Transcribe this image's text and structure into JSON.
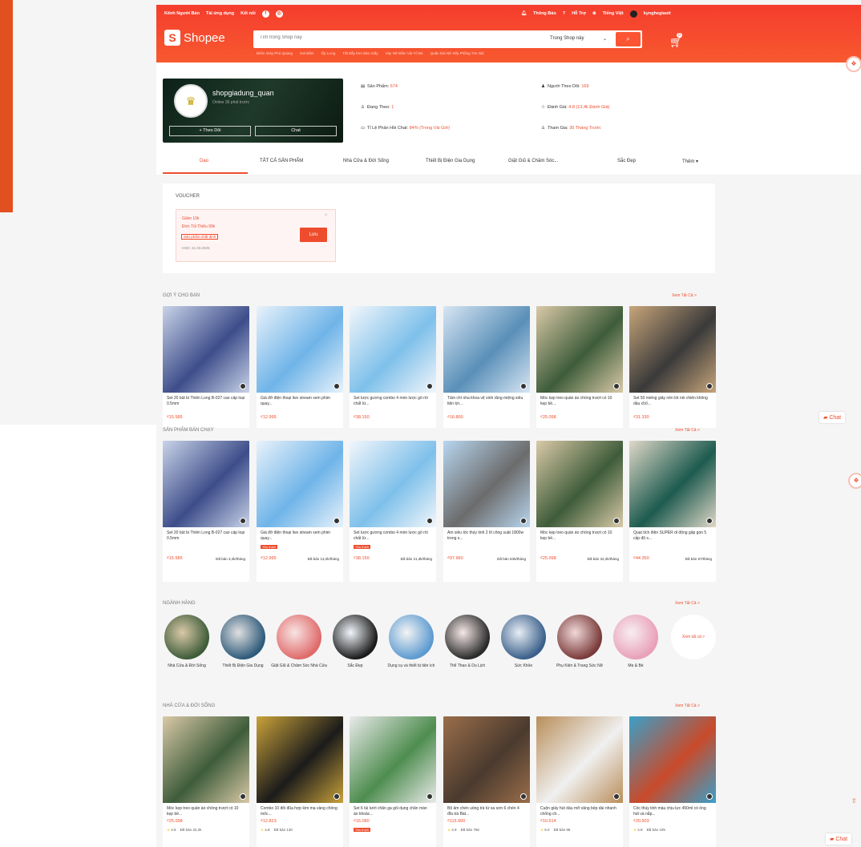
{
  "header": {
    "top_left": [
      "Kênh Người Bán",
      "Tải ứng dụng",
      "Kết nối"
    ],
    "top_right": [
      "Thông Báo",
      "Hỗ Trợ",
      "Tiếng Việt",
      "kynghegiaoit"
    ],
    "logo": "Shopee",
    "search_placeholder": "Tìm trong Shop này",
    "search_scope": "Trong Shop này",
    "suggestions": [
      "Điểm Giày Phú Quang",
      "Gel Bấm",
      "Ốp Lưng",
      "Tất Bẫy Kim Bảo Giấy",
      "Váy Nữ Đầm Vải Tổ Bé",
      "Quần Dài Nữ Xếp Phồng Tím Nội"
    ],
    "cart_count": "0"
  },
  "shop": {
    "name": "shopgiadung_quan",
    "status": "Online 36 phút trước",
    "follow": "+ Theo Dõi",
    "chat": "Chat",
    "stats": [
      {
        "label": "Sản Phẩm:",
        "value": "674"
      },
      {
        "label": "Người Theo Dõi:",
        "value": "169"
      },
      {
        "label": "Đang Theo:",
        "value": "1"
      },
      {
        "label": "Đánh Giá:",
        "value": "4.8 (13,4k Đánh Giá)"
      },
      {
        "label": "Tỉ Lệ Phản Hồi Chat:",
        "value": "84% (Trong Vài Giờ)"
      },
      {
        "label": "Tham Gia:",
        "value": "30 Tháng Trước"
      }
    ]
  },
  "tabs": [
    "Dạo",
    "TẤT CẢ SẢN PHẨM",
    "Nhà Cửa & Đời Sống",
    "Thiết Bị Điện Gia Dụng",
    "Giặt Giũ & Chăm Sóc...",
    "Sắc Đẹp",
    "Thêm ▾"
  ],
  "voucher": {
    "title": "VOUCHER",
    "line1": "Giảm 10k",
    "line2": "Đơn Tối Thiểu 99k",
    "condition": "Sản phẩm nhất định",
    "expiry": "HSD: 21.03.2025",
    "button": "Lưu"
  },
  "suggest": {
    "title": "GỢI Ý CHO BẠN",
    "see_all": "Xem Tất Cả >",
    "items": [
      {
        "name": "Set 20 bút bi Thiên Long B-027 cao cấp loại 0.5mm",
        "price": "₫15.585"
      },
      {
        "name": "Giá đỡ điện thoại live stream xem phim quay...",
        "price": "₫12.995"
      },
      {
        "name": "Set lược gương combo 4 món lược gỗ rối chất lừ...",
        "price": "₫38.150"
      },
      {
        "name": "Tấm chì nha khoa vệ sinh răng miệng siêu tiện lợi...",
        "price": "₫16.800"
      },
      {
        "name": "Móc kẹp treo quần áo chống trượt có 10 kẹp bề...",
        "price": "₫25.098"
      },
      {
        "name": "Set 50 miếng giấy nến lót nồi chiên không dầu chố...",
        "price": "₫31.330"
      }
    ]
  },
  "bestseller": {
    "title": "SẢN PHẨM BÁN CHẠY",
    "see_all": "Xem Tất Cả >",
    "items": [
      {
        "name": "Set 20 bút bi Thiên Long B-027 cao cấp loại 0.5mm",
        "price": "₫15.585",
        "sold": "Đã bán 3,4k/tháng",
        "tag": ""
      },
      {
        "name": "Giá đỡ điện thoại live stream xem phim quay...",
        "price": "₫12.995",
        "sold": "Đã bán 13,2k/tháng",
        "tag": "Yêu thích"
      },
      {
        "name": "Set lược gương combo 4 món lược gỗ rối chất lừ...",
        "price": "₫38.150",
        "sold": "Đã bán 21,3k/tháng",
        "tag": "Yêu thích"
      },
      {
        "name": "Ấm siêu tốc thủy tinh 2 lít công suất 1800w trong s...",
        "price": "₫97.960",
        "sold": "Đã bán 535/tháng",
        "tag": ""
      },
      {
        "name": "Móc kẹp treo quần áo chống trượt có 10 kẹp bề...",
        "price": "₫25.098",
        "sold": "Đã bán 32,2k/tháng",
        "tag": ""
      },
      {
        "name": "Quạt tích điện SUPER di động gấp gọn 5 cấp độ s...",
        "price": "₫44.350",
        "sold": "Đã bán 97/tháng",
        "tag": ""
      }
    ]
  },
  "categories": {
    "title": "NGÀNH HÀNG",
    "see_all": "Xem Tất Cả >",
    "more": "Xem tất cả >",
    "items": [
      "Nhà Cửa & Đời Sống",
      "Thiết Bị Điện Gia Dụng",
      "Giặt Giũ & Chăm Sóc Nhà Cửa",
      "Sắc Đẹp",
      "Dụng cụ và thiết bị tiện ích",
      "Thể Thao & Du Lịch",
      "Sức Khỏe",
      "Phụ Kiện & Trang Sức Nữ",
      "Mẹ & Bé"
    ]
  },
  "home_life": {
    "title": "NHÀ CỬA & ĐỜI SỐNG",
    "see_all": "Xem Tất Cả >",
    "items": [
      {
        "name": "Móc kẹp treo quần áo chống trượt có 10 kẹp bề...",
        "price": "₫25.098",
        "rating": "4.8",
        "sold": "Đã bán 32,2k",
        "tag": ""
      },
      {
        "name": "Combo 10 đôi đũa hợp kim mạ vàng chống mốc...",
        "price": "₫12.823",
        "rating": "4.8",
        "sold": "Đã bán 130",
        "tag": ""
      },
      {
        "name": "Set 6 túi lưới chăn ga gối dụng chăn màn áo khoác...",
        "price": "₫16.080",
        "rating": "",
        "sold": "",
        "tag": "Yêu thích"
      },
      {
        "name": "Bộ ấm chén uống trà tử sa sơn 6 chén 4 đĩa trà Bát...",
        "price": "₫115.000",
        "rating": "4.9",
        "sold": "Đã bán 756",
        "tag": ""
      },
      {
        "name": "Cuộn giấy hút dầu mỡ văng bếp dài nhanh chống ch...",
        "price": "₫10.614",
        "rating": "5.0",
        "sold": "Đã bán 98",
        "tag": ""
      },
      {
        "name": "Cốc thủy tinh màu chịu lực 450ml có ống hút và nắp...",
        "price": "₫20.503",
        "rating": "4.8",
        "sold": "Đã bán 105",
        "tag": ""
      }
    ]
  },
  "float": {
    "chat1": "Chat",
    "chat2": "Chat",
    "back_top": "⇧"
  },
  "colors": {
    "brand": "#ee4d2d",
    "header": "#f53d2d"
  }
}
